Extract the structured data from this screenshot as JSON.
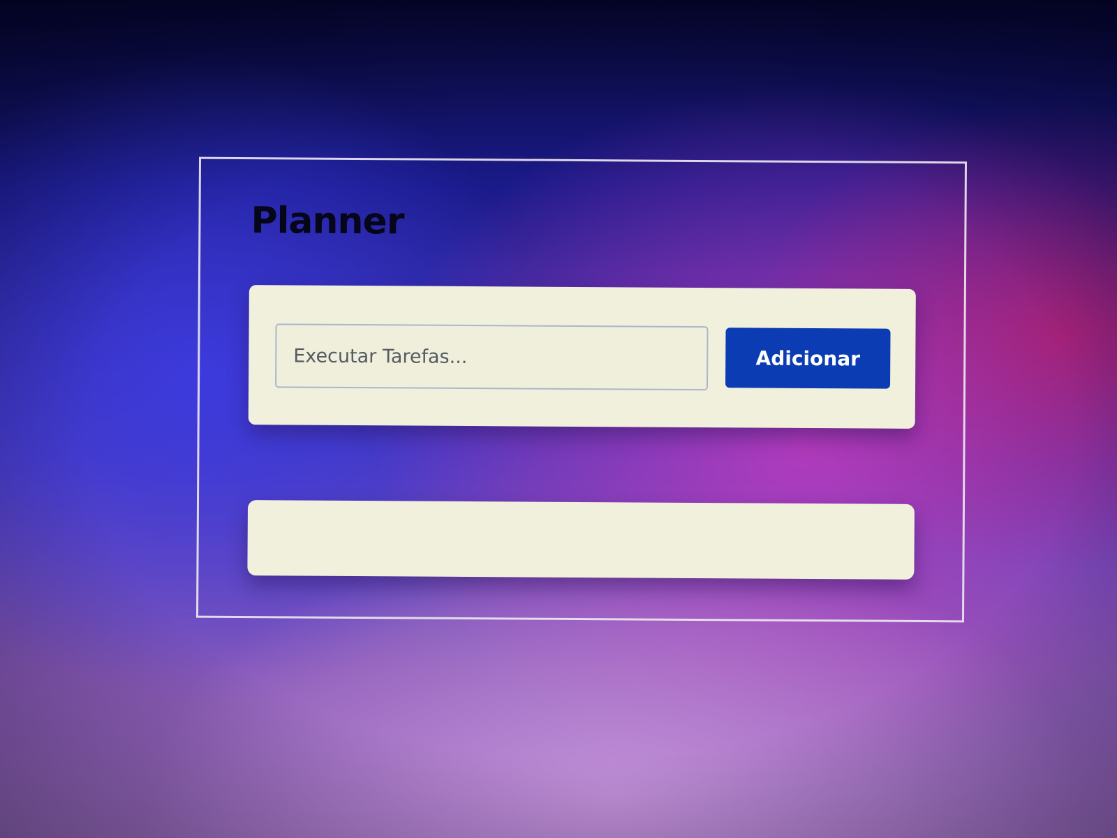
{
  "app": {
    "title": "Planner"
  },
  "task_form": {
    "input_placeholder": "Executar Tarefas...",
    "input_value": "",
    "add_button_label": "Adicionar"
  },
  "task_list": {
    "items": []
  },
  "colors": {
    "card_background": "#f1f0dd",
    "button_background": "#0c3cb4",
    "button_text": "#ffffff",
    "title_text": "#06061a",
    "frame_border": "#ebe6f0"
  }
}
